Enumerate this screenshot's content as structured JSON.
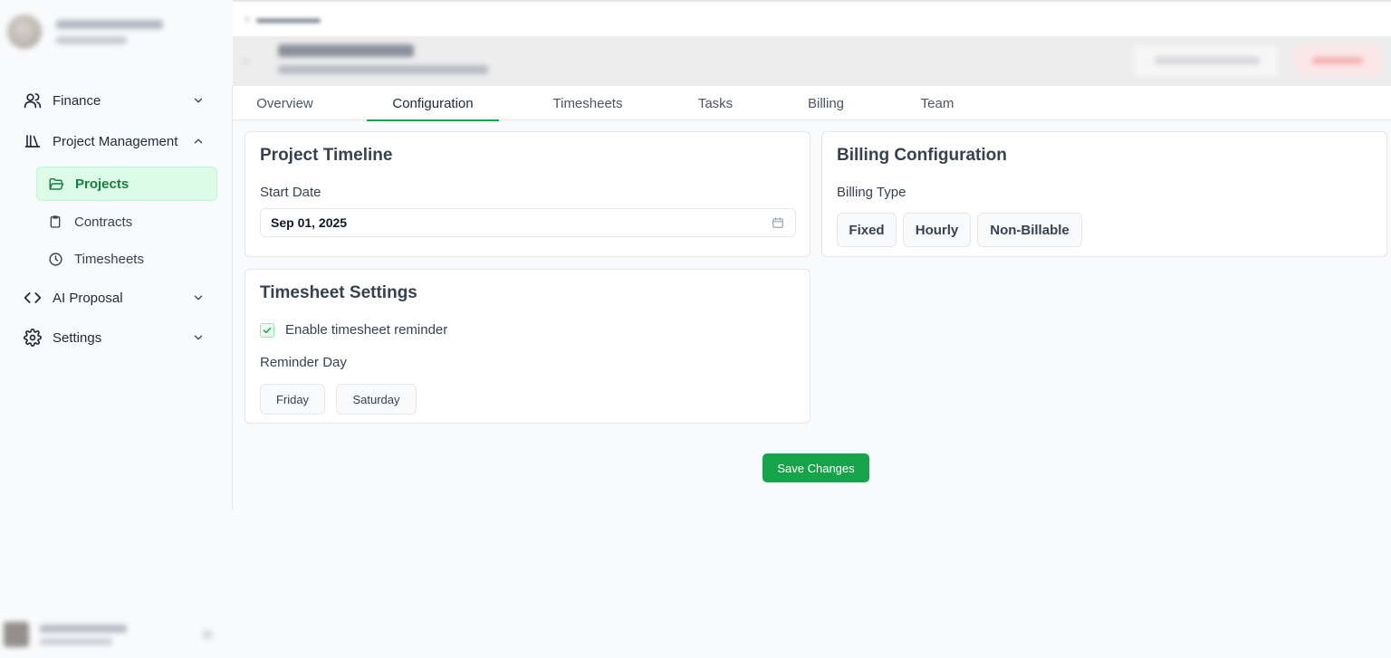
{
  "sidebar": {
    "nav": [
      {
        "label": "Finance",
        "icon": "users-icon",
        "expanded": false
      },
      {
        "label": "Project Management",
        "icon": "library-icon",
        "expanded": true
      },
      {
        "label": "AI Proposal",
        "icon": "code-icon",
        "expanded": false
      },
      {
        "label": "Settings",
        "icon": "gear-icon",
        "expanded": false
      }
    ],
    "sub_items": [
      {
        "label": "Projects",
        "icon": "folder-open-icon",
        "active": true
      },
      {
        "label": "Contracts",
        "icon": "clipboard-icon",
        "active": false
      },
      {
        "label": "Timesheets",
        "icon": "clock-icon",
        "active": false
      }
    ]
  },
  "tabs": [
    "Overview",
    "Configuration",
    "Timesheets",
    "Tasks",
    "Billing",
    "Team"
  ],
  "active_tab": "Configuration",
  "project_timeline": {
    "title": "Project Timeline",
    "start_date_label": "Start Date",
    "start_date_value": "Sep 01, 2025"
  },
  "billing_configuration": {
    "title": "Billing Configuration",
    "billing_type_label": "Billing Type",
    "options": [
      "Fixed",
      "Hourly",
      "Non-Billable"
    ]
  },
  "timesheet_settings": {
    "title": "Timesheet Settings",
    "reminder_label": "Enable timesheet reminder",
    "reminder_enabled": true,
    "reminder_day_label": "Reminder Day",
    "days": [
      "Friday",
      "Saturday"
    ]
  },
  "save_button": "Save Changes",
  "colors": {
    "accent": "#16a34a",
    "active_bg": "#dcfce7",
    "active_text": "#15803d",
    "border": "#e5e7eb"
  }
}
